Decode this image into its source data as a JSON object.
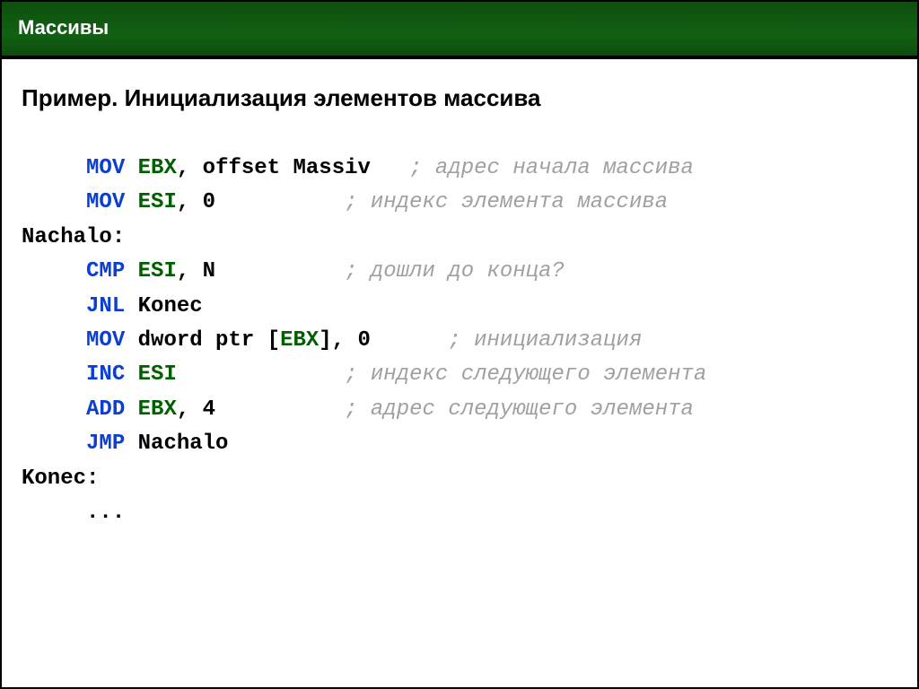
{
  "header": {
    "title": "Массивы"
  },
  "subtitle": "Пример. Инициализация элементов массива",
  "code": {
    "indent": "     ",
    "lines": [
      {
        "kw": "MOV",
        "reg": "EBX",
        "rest": ", offset Massiv   ",
        "cm": "; адрес начала массива"
      },
      {
        "kw": "MOV",
        "reg": "ESI",
        "rest": ", 0          ",
        "cm": "; индекс элемента массива"
      },
      {
        "label": "Nachalo:"
      },
      {
        "kw": "CMP",
        "reg": "ESI",
        "rest": ", N          ",
        "cm": "; дошли до конца?"
      },
      {
        "kw": "JNL",
        "rest2": " Konec"
      },
      {
        "kw": "MOV",
        "mid": " dword ptr [",
        "reg2": "EBX",
        "rest": "], 0      ",
        "cm": "; инициализация"
      },
      {
        "kw": "INC",
        "reg": "ESI",
        "rest": "             ",
        "cm": "; индекс следующего элемента"
      },
      {
        "kw": "ADD",
        "reg": "EBX",
        "rest": ", 4          ",
        "cm": "; адрес следующего элемента"
      },
      {
        "kw": "JMP",
        "rest2": " Nachalo"
      },
      {
        "label": "Konec:"
      },
      {
        "plain": "..."
      }
    ]
  }
}
